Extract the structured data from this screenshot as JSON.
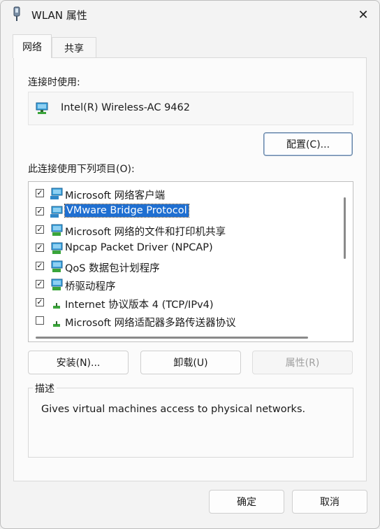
{
  "window": {
    "title": "WLAN 属性",
    "close_symbol": "✕"
  },
  "tabs": [
    {
      "label": "网络",
      "active": true
    },
    {
      "label": "共享",
      "active": false
    }
  ],
  "connect_using": {
    "label": "连接时使用:",
    "adapter": "Intel(R) Wireless-AC 9462",
    "configure_label": "配置(C)..."
  },
  "items_section": {
    "label": "此连接使用下列项目(O):",
    "items": [
      {
        "label": "Microsoft 网络客户端",
        "checked": true,
        "icon": "network-client-icon",
        "selected": false
      },
      {
        "label": "VMware Bridge Protocol",
        "checked": true,
        "icon": "network-service-icon",
        "selected": true
      },
      {
        "label": "Microsoft 网络的文件和打印机共享",
        "checked": true,
        "icon": "network-service-icon",
        "selected": false
      },
      {
        "label": "Npcap Packet Driver (NPCAP)",
        "checked": true,
        "icon": "network-service-icon",
        "selected": false
      },
      {
        "label": "QoS 数据包计划程序",
        "checked": true,
        "icon": "network-service-icon",
        "selected": false
      },
      {
        "label": "桥驱动程序",
        "checked": true,
        "icon": "network-service-icon",
        "selected": false
      },
      {
        "label": "Internet 协议版本 4 (TCP/IPv4)",
        "checked": true,
        "icon": "protocol-icon",
        "selected": false
      },
      {
        "label": "Microsoft 网络适配器多路传送器协议",
        "checked": false,
        "icon": "protocol-icon",
        "selected": false
      }
    ],
    "install_label": "安装(N)...",
    "uninstall_label": "卸载(U)",
    "properties_label": "属性(R)"
  },
  "description": {
    "label": "描述",
    "text": "Gives virtual machines access to physical networks."
  },
  "footer": {
    "ok_label": "确定",
    "cancel_label": "取消"
  },
  "colors": {
    "selection": "#1f6fd1",
    "accent_border": "#6b87a8"
  }
}
